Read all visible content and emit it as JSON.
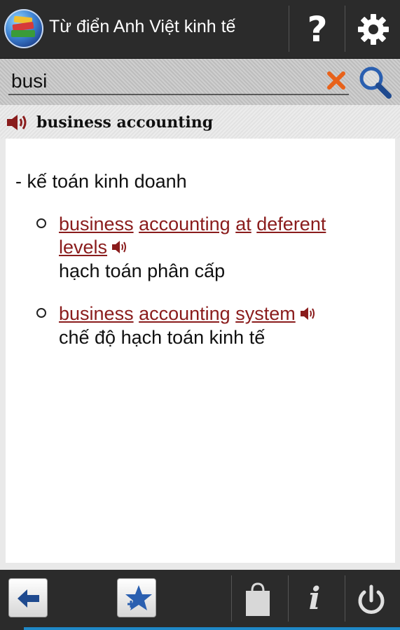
{
  "app": {
    "title": "Từ điển Anh Việt kinh tế",
    "icon": "dictionary-books-icon"
  },
  "header_actions": {
    "help_icon": "question-mark-icon",
    "help_glyph": "?",
    "settings_icon": "gear-icon"
  },
  "search": {
    "value": "busi",
    "clear_icon": "clear-x-icon",
    "search_icon": "magnifier-icon",
    "clear_color": "#e8621a",
    "search_color": "#2a5fb0"
  },
  "entry": {
    "word": "business accounting",
    "speaker_icon": "speaker-icon",
    "meaning": "- kế toán kinh doanh",
    "examples": [
      {
        "words": [
          "business",
          "accounting",
          "at",
          "deferent",
          "levels"
        ],
        "translation": "hạch toán phân cấp"
      },
      {
        "words": [
          "business",
          "accounting",
          "system"
        ],
        "translation": "chế độ hạch toán kinh tế"
      }
    ],
    "link_color": "#8a1c1c"
  },
  "bottom_bar": {
    "back_icon": "back-arrow-icon",
    "favorite_icon": "add-favorite-star-icon",
    "store_icon": "shopping-bag-icon",
    "info_icon": "info-icon",
    "info_glyph": "i",
    "power_icon": "power-icon"
  }
}
